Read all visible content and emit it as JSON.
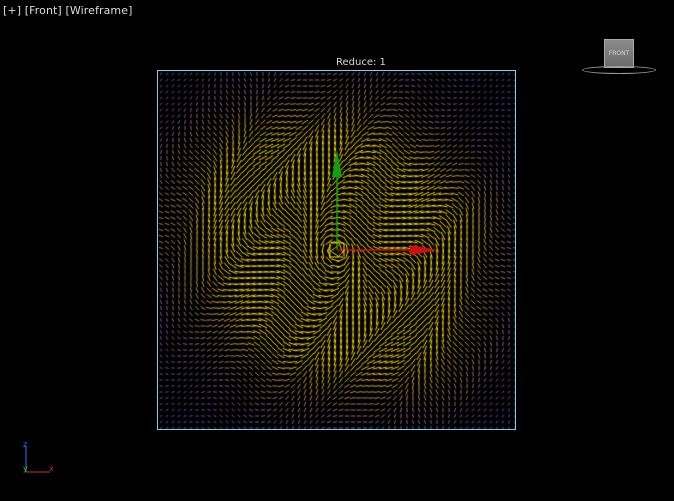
{
  "viewport": {
    "labels": [
      "[+]",
      "[Front]",
      "[Wireframe]"
    ],
    "reduce_label": "Reduce: 1"
  },
  "viewcube": {
    "face_label": "FRONT"
  },
  "axis_tripod": {
    "z": "z",
    "y": "y",
    "x": "x"
  },
  "colors": {
    "background": "#000000",
    "field_border": "#7fd0e6",
    "cold_vector": "#5a4fc0",
    "hot_vector": "#ffe000",
    "gizmo_x": "#d01010",
    "gizmo_y": "#10a010",
    "tripod_x": "#d03030",
    "tripod_y": "#30c030",
    "tripod_z": "#3070ff"
  },
  "icons": {
    "gizmo": "move-gizmo-icon",
    "viewcube": "viewcube-icon",
    "tripod": "axis-tripod-icon"
  }
}
